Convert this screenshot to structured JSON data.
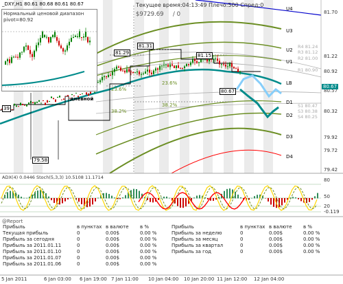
{
  "header": {
    "symbol_line": "_DXY,H1  80.61 80.68 80.61 80.67",
    "panel_title": "Нормальный ценовой диапазон",
    "pivot_label": "pivot=80.92",
    "tf_label": "дневной",
    "server_time_label": "Текущее время:04:13:49  Плечо:500  Спред:0",
    "balance_label": "$9729.69",
    "risk_label": "/ 0"
  },
  "levels": [
    {
      "label": "U4",
      "color": "#0000cc"
    },
    {
      "label": "U3",
      "color": "#6b8e23"
    },
    {
      "label": "U2",
      "color": "#6b8e23"
    },
    {
      "label": "U1",
      "color": "#6b8e23"
    },
    {
      "label": "LB",
      "color": "#008080"
    },
    {
      "label": "D1",
      "color": "#6b8e23"
    },
    {
      "label": "D2",
      "color": "#6b8e23"
    },
    {
      "label": "D3",
      "color": "#6b8e23"
    },
    {
      "label": "D4",
      "color": "#ff0000"
    }
  ],
  "resistance_labels": [
    "R4 81.24",
    "R3 81.12",
    "R2 81.00",
    "R1 80.90",
    "S1 80.47",
    "S3 80.38",
    "S4 80.25"
  ],
  "price_axis": [
    "81.70",
    "81.22",
    "80.92",
    "80.57",
    "80.32",
    "79.92",
    "79.72",
    "79.42"
  ],
  "current_price": "80.67",
  "chart_tags": [
    "81.29",
    "81.31",
    "81.15",
    "80.67",
    "79.58",
    "39"
  ],
  "percent_labels": [
    "23.6%",
    "23.6%",
    "38.2%",
    "38.2%"
  ],
  "indicator": {
    "title": "ADX(4) 0.0446  Stoch(5,3,3) 10.5108 11.1714",
    "axis": [
      "80",
      "50",
      "20",
      "-0.119"
    ]
  },
  "time_axis": [
    "5 Jan 2011",
    "6 Jan 03:00",
    "6 Jan 19:00",
    "7 Jan 11:00",
    "10 Jan 04:00",
    "10 Jan 20:00",
    "11 Jan 12:00",
    "12 Jan 04:00"
  ],
  "report": {
    "title": "@Report",
    "left_headers": [
      "Прибыль",
      "в пунктах",
      "в валюте",
      "в %"
    ],
    "left_rows": [
      [
        "Текущая прибыль",
        "0",
        "0.00$",
        "0.00 %"
      ],
      [
        "Прибыль за сегодня",
        "0",
        "0.00$",
        "0.00 %"
      ],
      [
        "Прибыль за 2011.01.11",
        "0",
        "0.00$",
        "0.00 %"
      ],
      [
        "Прибыль за 2011.01.10",
        "0",
        "0.00$",
        "0.00 %"
      ],
      [
        "Прибыль за 2011.01.07",
        "0",
        "0.00$",
        "0.00 %"
      ],
      [
        "Прибыль за 2011.01.06",
        "0",
        "0.00$",
        "0.00 %"
      ]
    ],
    "right_headers": [
      "Прибыль",
      "в пунктах",
      "в валюте",
      "в %"
    ],
    "right_rows": [
      [
        "Прибыль за неделю",
        "0",
        "0.00$",
        "0.00 %"
      ],
      [
        "Прибыль за месяц",
        "0",
        "0.00$",
        "0.00 %"
      ],
      [
        "Прибыль за квартал",
        "0",
        "0.00$",
        "0.00 %"
      ],
      [
        "Прибыль за год",
        "0",
        "0.00$",
        "0.00 %"
      ]
    ]
  }
}
